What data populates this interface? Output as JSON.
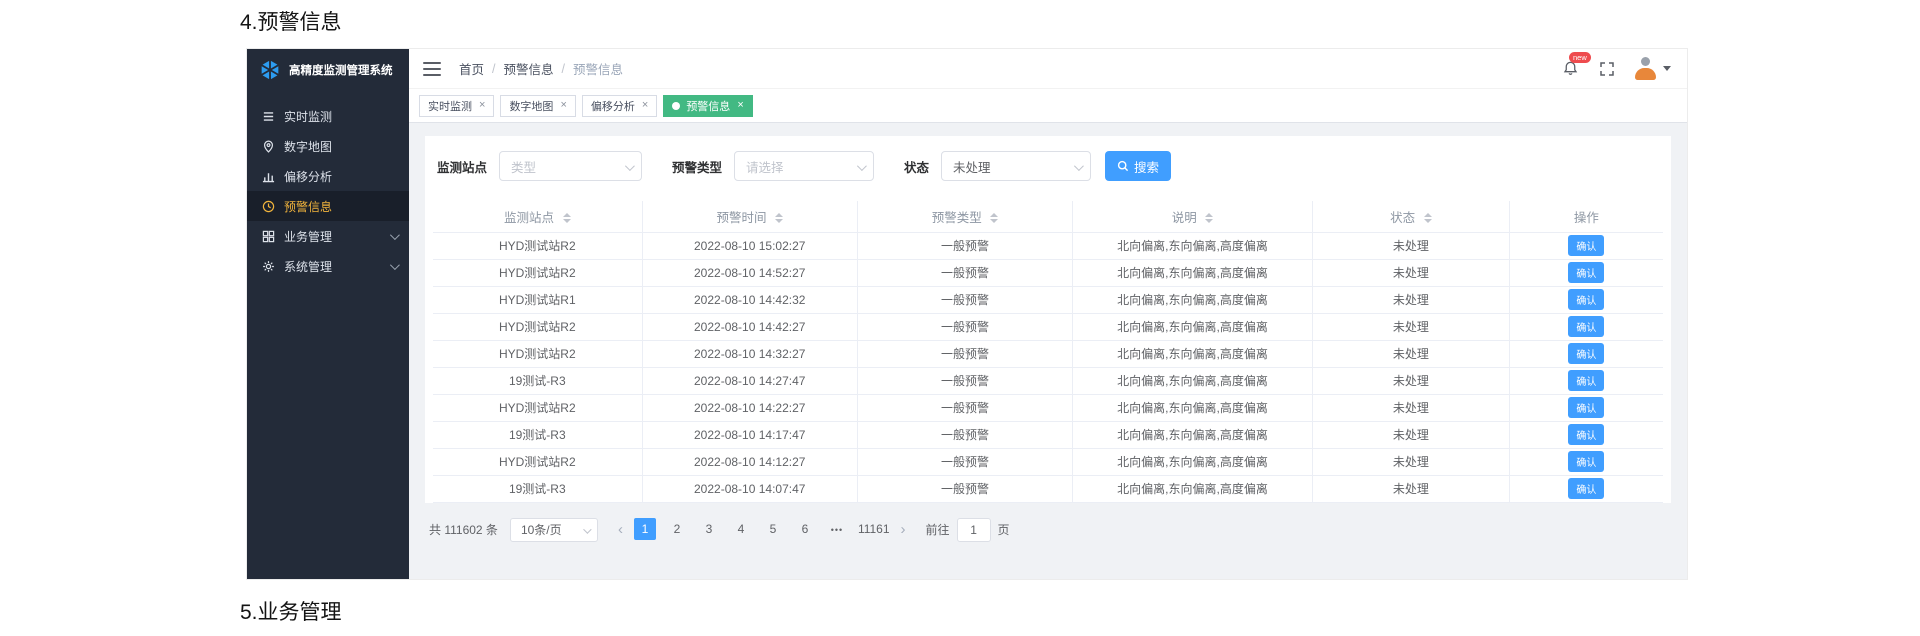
{
  "page": {
    "heading_top": "4.预警信息",
    "heading_bottom": "5.业务管理"
  },
  "glyphs": {
    "close": "×",
    "breadcrumb_sep": "/",
    "prev": "‹",
    "next": "›",
    "ellipsis": "•••"
  },
  "colors": {
    "accent_blue": "#409EFF",
    "active_tag_green": "#42B983",
    "sidebar_bg": "#232B39",
    "sidebar_active_text": "#F0B33C",
    "badge_red": "#EE4B4E"
  },
  "sidebar": {
    "logo_text": "高精度监测管理系统",
    "items": [
      {
        "label": "实时监测",
        "icon": "list-icon",
        "active": false
      },
      {
        "label": "数字地图",
        "icon": "map-pin-icon",
        "active": false
      },
      {
        "label": "偏移分析",
        "icon": "bar-chart-icon",
        "active": false
      },
      {
        "label": "预警信息",
        "icon": "clock-icon",
        "active": true
      },
      {
        "label": "业务管理",
        "icon": "grid-icon",
        "active": false,
        "expandable": true
      },
      {
        "label": "系统管理",
        "icon": "gear-icon",
        "active": false,
        "expandable": true
      }
    ]
  },
  "navbar": {
    "breadcrumb": [
      "首页",
      "预警信息",
      "预警信息"
    ],
    "badge": "new"
  },
  "tabs": [
    {
      "label": "实时监测",
      "active": false
    },
    {
      "label": "数字地图",
      "active": false
    },
    {
      "label": "偏移分析",
      "active": false
    },
    {
      "label": "预警信息",
      "active": true
    }
  ],
  "filters": {
    "station_label": "监测站点",
    "station_placeholder": "类型",
    "type_label": "预警类型",
    "type_placeholder": "请选择",
    "status_label": "状态",
    "status_value": "未处理",
    "search_label": "搜索"
  },
  "table": {
    "columns": [
      "监测站点",
      "预警时间",
      "预警类型",
      "说明",
      "状态",
      "操作"
    ],
    "confirm_label": "确认",
    "rows": [
      {
        "station": "HYD测试站R2",
        "time": "2022-08-10 15:02:27",
        "type": "一般预警",
        "desc": "北向偏离,东向偏离,高度偏离",
        "status": "未处理"
      },
      {
        "station": "HYD测试站R2",
        "time": "2022-08-10 14:52:27",
        "type": "一般预警",
        "desc": "北向偏离,东向偏离,高度偏离",
        "status": "未处理"
      },
      {
        "station": "HYD测试站R1",
        "time": "2022-08-10 14:42:32",
        "type": "一般预警",
        "desc": "北向偏离,东向偏离,高度偏离",
        "status": "未处理"
      },
      {
        "station": "HYD测试站R2",
        "time": "2022-08-10 14:42:27",
        "type": "一般预警",
        "desc": "北向偏离,东向偏离,高度偏离",
        "status": "未处理"
      },
      {
        "station": "HYD测试站R2",
        "time": "2022-08-10 14:32:27",
        "type": "一般预警",
        "desc": "北向偏离,东向偏离,高度偏离",
        "status": "未处理"
      },
      {
        "station": "19测试-R3",
        "time": "2022-08-10 14:27:47",
        "type": "一般预警",
        "desc": "北向偏离,东向偏离,高度偏离",
        "status": "未处理"
      },
      {
        "station": "HYD测试站R2",
        "time": "2022-08-10 14:22:27",
        "type": "一般预警",
        "desc": "北向偏离,东向偏离,高度偏离",
        "status": "未处理"
      },
      {
        "station": "19测试-R3",
        "time": "2022-08-10 14:17:47",
        "type": "一般预警",
        "desc": "北向偏离,东向偏离,高度偏离",
        "status": "未处理"
      },
      {
        "station": "HYD测试站R2",
        "time": "2022-08-10 14:12:27",
        "type": "一般预警",
        "desc": "北向偏离,东向偏离,高度偏离",
        "status": "未处理"
      },
      {
        "station": "19测试-R3",
        "time": "2022-08-10 14:07:47",
        "type": "一般预警",
        "desc": "北向偏离,东向偏离,高度偏离",
        "status": "未处理"
      }
    ]
  },
  "pagination": {
    "total_text": "共 111602 条",
    "page_size": "10条/页",
    "pages": [
      "1",
      "2",
      "3",
      "4",
      "5",
      "6",
      "•••",
      "11161"
    ],
    "active_page": "1",
    "goto_label": "前往",
    "goto_value": "1",
    "goto_suffix": "页"
  }
}
